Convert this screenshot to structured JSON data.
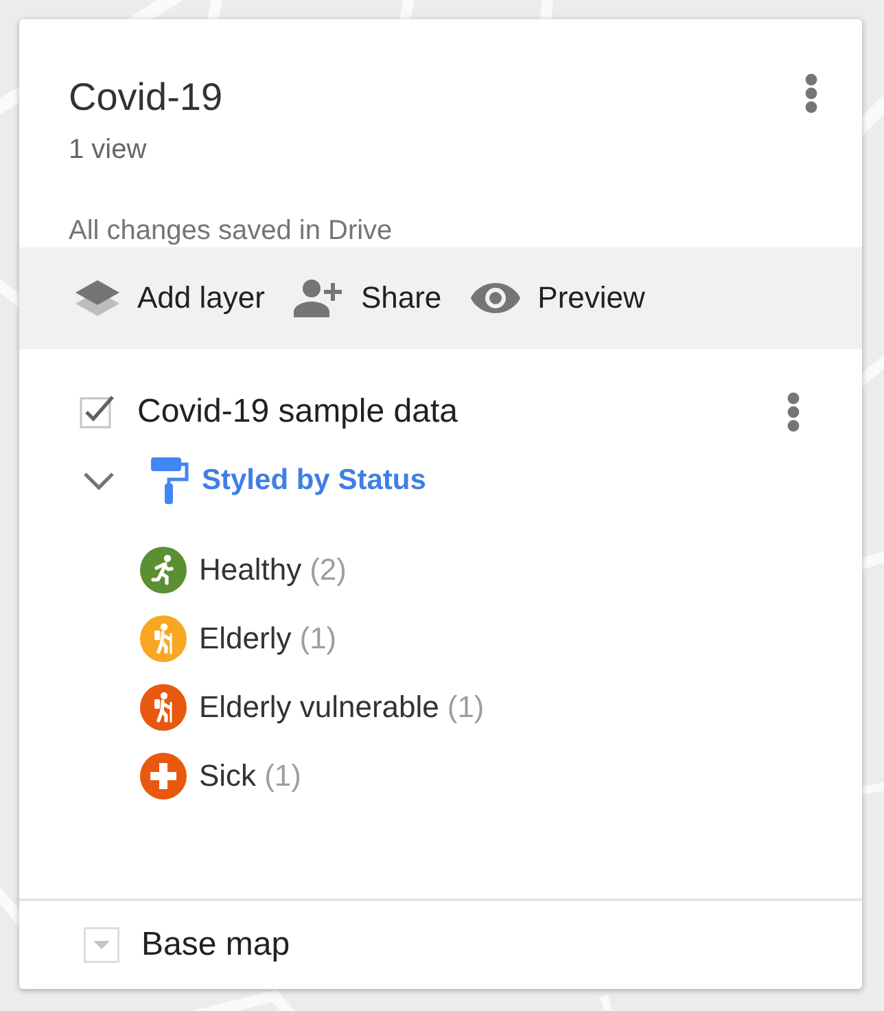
{
  "map_title": "Covid-19",
  "views": "1 view",
  "save_status": "All changes saved in Drive",
  "toolbar": [
    {
      "kind": "add_layer",
      "label": "Add layer"
    },
    {
      "kind": "share",
      "label": "Share"
    },
    {
      "kind": "preview",
      "label": "Preview"
    }
  ],
  "layer": {
    "name": "Covid-19 sample data",
    "checked": true,
    "expanded": true,
    "style_label": "Styled by Status",
    "legend": [
      {
        "kind": "runner",
        "label": "Healthy",
        "count": "(2)",
        "color": "#5a8f33"
      },
      {
        "kind": "hiker",
        "label": "Elderly",
        "count": "(1)",
        "color": "#f8a723"
      },
      {
        "kind": "hiker",
        "label": "Elderly vulnerable",
        "count": "(1)",
        "color": "#e8580e"
      },
      {
        "kind": "cross",
        "label": "Sick",
        "count": "(1)",
        "color": "#e8580e"
      }
    ]
  },
  "base_map": {
    "label": "Base map"
  }
}
